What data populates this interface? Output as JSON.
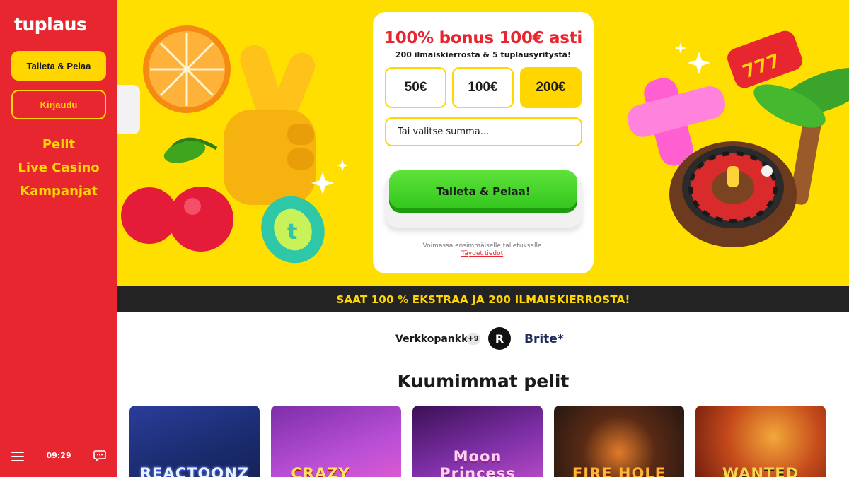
{
  "brand": {
    "logo_text": "tuplaus",
    "primary_color": "#e8262f",
    "accent_color": "#ffd600"
  },
  "sidebar": {
    "deposit_button": "Talleta & Pelaa",
    "login_button": "Kirjaudu",
    "nav": [
      "Pelit",
      "Live Casino",
      "Kampanjat"
    ],
    "footer": {
      "menu_icon": "hamburger-icon",
      "time": "09:29",
      "chat_icon": "chat-icon"
    }
  },
  "bonus": {
    "title": "100% bonus 100€ asti",
    "subtitle": "200 ilmaiskierrosta & 5 tuplausyritystä!",
    "amounts": [
      "50€",
      "100€",
      "200€"
    ],
    "selected_amount": "200€",
    "input_placeholder": "Tai valitse summa...",
    "cta": "Talleta & Pelaa!",
    "terms_text": "Voimassa ensimmäiselle talletukselle.",
    "terms_link": "Täydet tiedot",
    "terms_suffix": "."
  },
  "banner": {
    "text": "SAAT 100 % EKSTRAA JA 200 ILMAISKIERROSTA!"
  },
  "payments": {
    "bank_label": "Verkkopankki",
    "more_count": "+9",
    "revolut_letter": "R",
    "brite_label": "Brite*"
  },
  "hottest": {
    "title": "Kuumimmat pelit",
    "games": [
      "REACTOONZ",
      "CRAZY",
      "Moon Princess",
      "FIRE HOLE",
      "WANTED"
    ]
  }
}
